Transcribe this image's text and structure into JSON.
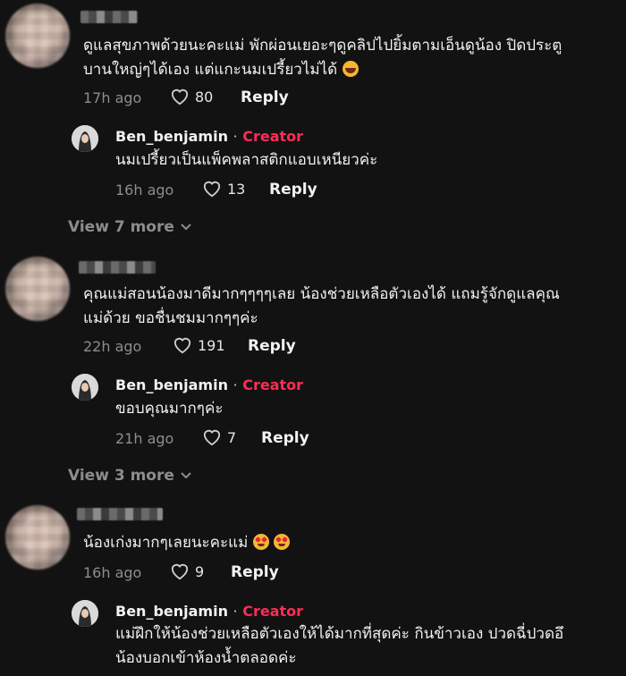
{
  "comments": [
    {
      "text_line1": "ดูแลสุขภาพด้วยนะคะแม่ พักผ่อนเยอะๆดูคลิปไปยิ้มตามเอ็นดูน้อง ปิดประตู",
      "text_line2": "บานใหญ่ๆได้เอง แต่แกะนมเปรี้ยวไม่ได้",
      "emoji": "laughing-emoji",
      "time": "17h ago",
      "likes": "80",
      "reply_label": "Reply",
      "reply": {
        "username": "Ben_benjamin",
        "separator": "·",
        "creator_label": "Creator",
        "text": "นมเปรี้ยวเป็นแพ็คพลาสติกแอบเหนียวค่ะ",
        "time": "16h ago",
        "likes": "13",
        "reply_label": "Reply"
      },
      "view_more": "View 7 more"
    },
    {
      "text_line1": "คุณแม่สอนน้องมาดีมากๆๆๆๆเลย น้องช่วยเหลือตัวเองได้ แถมรู้จักดูแลคุณ",
      "text_line2": "แม่ด้วย ขอชื่นชมมากๆๆค่ะ",
      "time": "22h ago",
      "likes": "191",
      "reply_label": "Reply",
      "reply": {
        "username": "Ben_benjamin",
        "separator": "·",
        "creator_label": "Creator",
        "text": "ขอบคุณมากๆค่ะ",
        "time": "21h ago",
        "likes": "7",
        "reply_label": "Reply"
      },
      "view_more": "View 3 more"
    },
    {
      "text_line1": "น้องเก่งมากๆเลยนะคะแม่",
      "emoji": "heart-eyes-emoji",
      "time": "16h ago",
      "likes": "9",
      "reply_label": "Reply",
      "reply": {
        "username": "Ben_benjamin",
        "separator": "·",
        "creator_label": "Creator",
        "text_line1": "แม่ฝึกให้น้องช่วยเหลือตัวเองให้ได้มากที่สุดค่ะ กินข้าวเอง ปวดฉี่ปวดอึ",
        "text_line2": "น้องบอกเข้าห้องน้ำตลอดค่ะ"
      }
    }
  ],
  "colors": {
    "background": "#121212",
    "creator": "#fe2c55",
    "muted": "#8d8d8d"
  }
}
